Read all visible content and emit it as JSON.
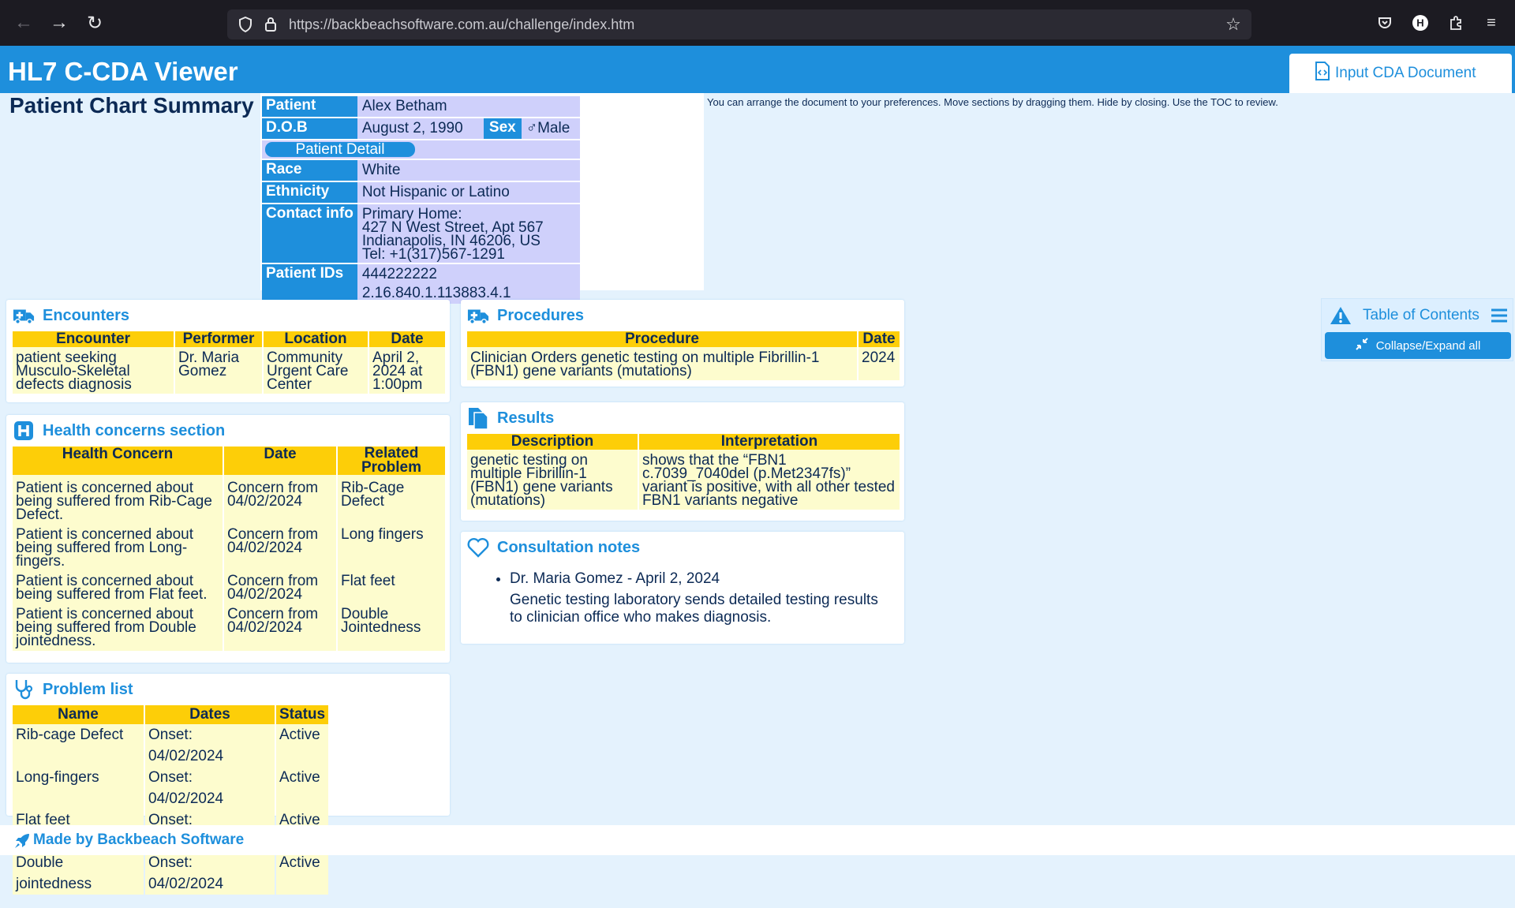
{
  "browser": {
    "url": "https://backbeachsoftware.com.au/challenge/index.htm"
  },
  "app": {
    "title": "HL7 C-CDA Viewer",
    "input_button": "Input CDA Document"
  },
  "summary": {
    "title": "Patient Chart Summary",
    "instructions": "You can arrange the document to your preferences. Move sections by dragging them. Hide by closing. Use the TOC to review.",
    "labels": {
      "patient": "Patient",
      "dob": "D.O.B",
      "sex": "Sex",
      "race": "Race",
      "ethnicity": "Ethnicity",
      "contact": "Contact info",
      "ids": "Patient IDs"
    },
    "patient": "Alex Betham",
    "dob": "August 2, 1990",
    "sex": "♂Male",
    "detail_button": "Patient Detail",
    "race": "White",
    "ethnicity": "Not Hispanic or Latino",
    "contact": [
      "Primary Home:",
      "427 N West Street, Apt 567",
      "Indianapolis, IN 46206, US",
      "Tel: +1(317)567-1291"
    ],
    "ids": "444222222 2.16.840.1.113883.4.1"
  },
  "encounters": {
    "title": "Encounters",
    "headers": [
      "Encounter",
      "Performer",
      "Location",
      "Date"
    ],
    "row": [
      "patient seeking Musculo-Skeletal defects diagnosis",
      "Dr. Maria Gomez",
      "Community Urgent Care Center",
      "April 2, 2024 at 1:00pm"
    ]
  },
  "procedures": {
    "title": "Procedures",
    "headers": [
      "Procedure",
      "Date"
    ],
    "row": [
      "Clinician Orders genetic testing on multiple Fibrillin-1 (FBN1) gene variants (mutations)",
      "2024"
    ]
  },
  "results": {
    "title": "Results",
    "headers": [
      "Description",
      "Interpretation"
    ],
    "row": [
      "genetic testing on multiple Fibrillin-1 (FBN1) gene variants (mutations)",
      "shows that the “FBN1 c.7039_7040del (p.Met2347fs)” variant is positive, with all other tested FBN1 variants negative"
    ]
  },
  "health_concerns": {
    "title": "Health concerns section",
    "headers": [
      "Health Concern",
      "Date",
      "Related Problem"
    ],
    "rows": [
      [
        "Patient is concerned about being suffered from Rib-Cage Defect.",
        "Concern from 04/02/2024",
        "Rib-Cage Defect"
      ],
      [
        "Patient is concerned about being suffered from Long-fingers.",
        "Concern from 04/02/2024",
        "Long fingers"
      ],
      [
        "Patient is concerned about being suffered from Flat feet.",
        "Concern from 04/02/2024",
        "Flat feet"
      ],
      [
        "Patient is concerned about being suffered from Double jointedness.",
        "Concern from 04/02/2024",
        "Double Jointedness"
      ]
    ]
  },
  "consultation": {
    "title": "Consultation notes",
    "author": "Dr. Maria Gomez - April 2, 2024",
    "note": "Genetic testing laboratory sends detailed testing results to clinician office who makes diagnosis."
  },
  "problems": {
    "title": "Problem list",
    "headers": [
      "Name",
      "Dates",
      "Status"
    ],
    "rows": [
      [
        "Rib-cage Defect",
        "Onset: 04/02/2024",
        "Active"
      ],
      [
        "Long-fingers",
        "Onset: 04/02/2024",
        "Active"
      ],
      [
        "Flat feet",
        "Onset: 04/02/2024",
        "Active"
      ],
      [
        "Double jointedness",
        "Onset: 04/02/2024",
        "Active"
      ]
    ]
  },
  "toc": {
    "title": "Table of Contents",
    "collapse_button": "Collapse/Expand all"
  },
  "footer": {
    "text": "Made by Backbeach Software"
  }
}
